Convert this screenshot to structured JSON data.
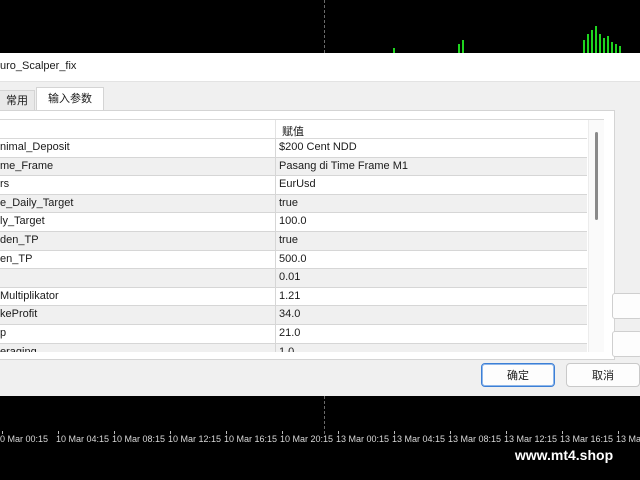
{
  "dialog": {
    "title": "uro_Scalper_fix",
    "tabs": [
      {
        "label": "常用",
        "active": false
      },
      {
        "label": "输入参数",
        "active": true
      }
    ],
    "table": {
      "header_name": "",
      "header_value": "赋值",
      "rows": [
        {
          "name": "nimal_Deposit",
          "value": "$200 Cent NDD"
        },
        {
          "name": "me_Frame",
          "value": "Pasang di Time Frame M1"
        },
        {
          "name": "rs",
          "value": "EurUsd"
        },
        {
          "name": "e_Daily_Target",
          "value": "true"
        },
        {
          "name": "ly_Target",
          "value": "100.0"
        },
        {
          "name": "den_TP",
          "value": "true"
        },
        {
          "name": "en_TP",
          "value": "500.0"
        },
        {
          "name": "",
          "value": "0.01"
        },
        {
          "name": "Multiplikator",
          "value": "1.21"
        },
        {
          "name": "keProfit",
          "value": "34.0"
        },
        {
          "name": "p",
          "value": "21.0"
        },
        {
          "name": "eraging",
          "value": "1.0"
        }
      ]
    },
    "buttons": {
      "ok_label": "确定",
      "cancel_label": "取消"
    }
  },
  "chart": {
    "time_labels": [
      "0 Mar 00:15",
      "10 Mar 04:15",
      "10 Mar 08:15",
      "10 Mar 12:15",
      "10 Mar 16:15",
      "10 Mar 20:15",
      "13 Mar 00:15",
      "13 Mar 04:15",
      "13 Mar 08:15",
      "13 Mar 12:15",
      "13 Mar 16:15",
      "13 Ma"
    ],
    "candle_color": "#1fd41f"
  },
  "watermark": "www.mt4.shop"
}
